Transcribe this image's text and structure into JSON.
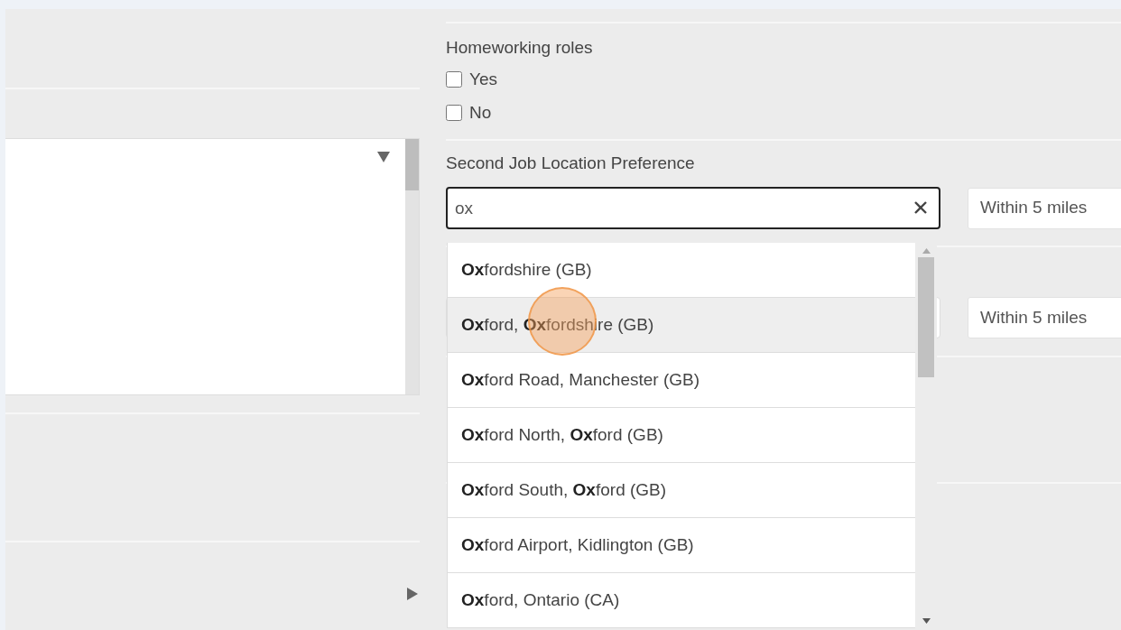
{
  "homeworking": {
    "label": "Homeworking roles",
    "options": [
      {
        "label": "Yes",
        "checked": false
      },
      {
        "label": "No",
        "checked": false
      }
    ]
  },
  "location": {
    "label": "Second Job Location Preference",
    "value": "ox",
    "radius": "Within 5 miles",
    "suggestions": [
      {
        "text": "**Ox**fordshire (GB)",
        "selected": false
      },
      {
        "text": "**Ox**ford, **Ox**fordshire (GB)",
        "selected": true
      },
      {
        "text": "**Ox**ford Road, Manchester (GB)",
        "selected": false
      },
      {
        "text": "**Ox**ford North, **Ox**ford (GB)",
        "selected": false
      },
      {
        "text": "**Ox**ford South, **Ox**ford (GB)",
        "selected": false
      },
      {
        "text": "**Ox**ford Airport, Kidlington (GB)",
        "selected": false
      },
      {
        "text": "**Ox**ford, Ontario (CA)",
        "selected": false
      }
    ]
  },
  "second_location": {
    "radius": "Within 5 miles"
  }
}
